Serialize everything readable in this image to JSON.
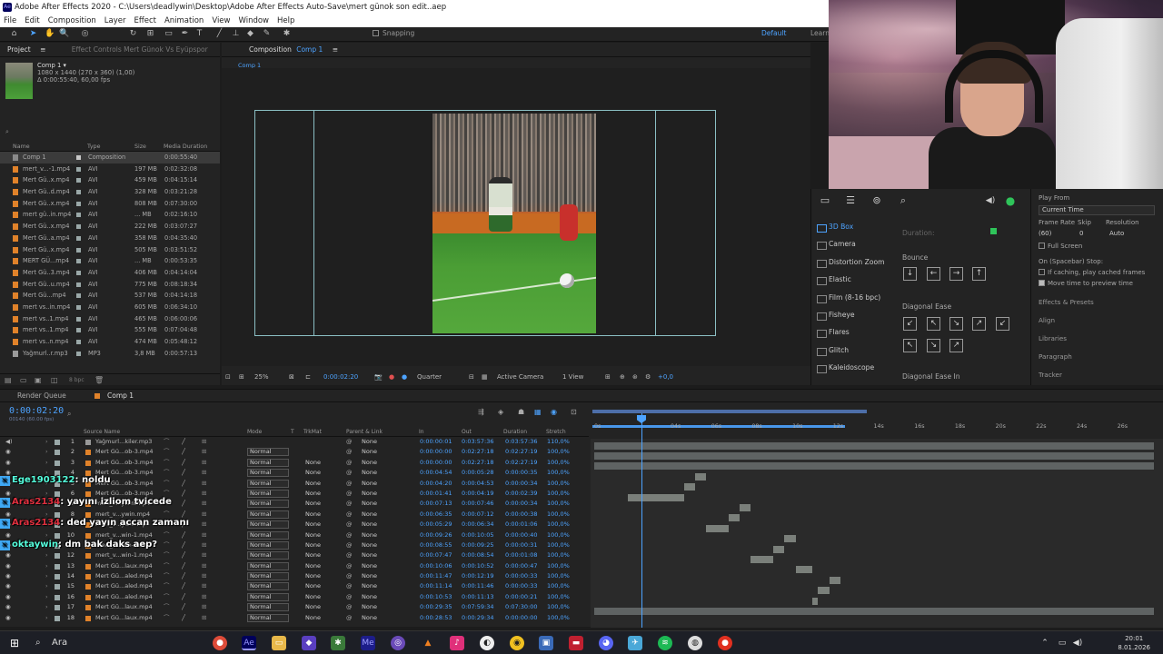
{
  "window": {
    "title": "Adobe After Effects 2020 - C:\\Users\\deadlywin\\Desktop\\Adobe After Effects Auto-Save\\mert günok son edit..aep"
  },
  "menu": [
    "File",
    "Edit",
    "Composition",
    "Layer",
    "Effect",
    "Animation",
    "View",
    "Window",
    "Help"
  ],
  "toolbar": {
    "snapping": "Snapping",
    "workspace": "Default",
    "learn": "Learn"
  },
  "project": {
    "tab": "Project",
    "tab2": "Effect Controls Mert Günok Vs Eyüpspor",
    "comp_name": "Comp 1 ▾",
    "comp_info1": "1080 x 1440  (270 x 360) (1,00)",
    "comp_info2": "Δ 0:00:55:40, 60,00 fps",
    "columns": {
      "name": "Name",
      "type": "Type",
      "size": "Size",
      "duration": "Media Duration"
    },
    "items": [
      {
        "name": "Comp 1",
        "type": "Composition",
        "size": "",
        "duration": "0:00:55:40",
        "kind": "comp"
      },
      {
        "name": "mert_v...-1.mp4",
        "type": "AVI",
        "size": "197 MB",
        "duration": "0:02:32:08",
        "kind": "avi"
      },
      {
        "name": "Mert Gü..x.mp4",
        "type": "AVI",
        "size": "459 MB",
        "duration": "0:04:15:14",
        "kind": "avi"
      },
      {
        "name": "Mert Gü..d.mp4",
        "type": "AVI",
        "size": "328 MB",
        "duration": "0:03:21:28",
        "kind": "avi"
      },
      {
        "name": "Mert Gü..x.mp4",
        "type": "AVI",
        "size": "808 MB",
        "duration": "0:07:30:00",
        "kind": "avi"
      },
      {
        "name": "mert gü..in.mp4",
        "type": "AVI",
        "size": "... MB",
        "duration": "0:02:16:10",
        "kind": "avi"
      },
      {
        "name": "Mert Gü..x.mp4",
        "type": "AVI",
        "size": "222 MB",
        "duration": "0:03:07:27",
        "kind": "avi"
      },
      {
        "name": "Mert Gü..a.mp4",
        "type": "AVI",
        "size": "358 MB",
        "duration": "0:04:35:40",
        "kind": "avi"
      },
      {
        "name": "Mert Gü..x.mp4",
        "type": "AVI",
        "size": "505 MB",
        "duration": "0:03:51:52",
        "kind": "avi"
      },
      {
        "name": "MERT GÜ...mp4",
        "type": "AVI",
        "size": "... MB",
        "duration": "0:00:53:35",
        "kind": "avi"
      },
      {
        "name": "Mert Gü..3.mp4",
        "type": "AVI",
        "size": "406 MB",
        "duration": "0:04:14:04",
        "kind": "avi"
      },
      {
        "name": "Mert Gü..u.mp4",
        "type": "AVI",
        "size": "775 MB",
        "duration": "0:08:18:34",
        "kind": "avi"
      },
      {
        "name": "Mert Gü...mp4",
        "type": "AVI",
        "size": "537 MB",
        "duration": "0:04:14:18",
        "kind": "avi"
      },
      {
        "name": "mert vs..in.mp4",
        "type": "AVI",
        "size": "605 MB",
        "duration": "0:06:34:10",
        "kind": "avi"
      },
      {
        "name": "mert vs..1.mp4",
        "type": "AVI",
        "size": "465 MB",
        "duration": "0:06:00:06",
        "kind": "avi"
      },
      {
        "name": "mert vs..1.mp4",
        "type": "AVI",
        "size": "555 MB",
        "duration": "0:07:04:48",
        "kind": "avi"
      },
      {
        "name": "mert vs..n.mp4",
        "type": "AVI",
        "size": "474 MB",
        "duration": "0:05:48:12",
        "kind": "avi"
      },
      {
        "name": "Yağmurl..r.mp3",
        "type": "MP3",
        "size": "3,8 MB",
        "duration": "0:00:57:13",
        "kind": "mp3"
      }
    ],
    "bpc": "8 bpc"
  },
  "composition": {
    "tab": "Composition",
    "tab_name": "Comp 1",
    "breadcrumb": "Comp 1",
    "zoom": "25%",
    "timecode": "0:00:02:20",
    "resolution": "Quarter",
    "camera": "Active Camera",
    "views": "1 View",
    "exposure": "+0,0"
  },
  "effects": {
    "items": [
      "3D Box",
      "Camera",
      "Distortion Zoom",
      "Elastic",
      "Film (8-16 bpc)",
      "Fisheye",
      "Flares",
      "Glitch",
      "Kaleidoscope"
    ],
    "duration_label": "Duration:",
    "bounce": "Bounce",
    "diag1": "Diagonal Ease",
    "diag2": "Diagonal Ease In"
  },
  "preview": {
    "play_from": "Play From",
    "current_time": "Current Time",
    "frame_rate": "Frame Rate",
    "skip": "Skip",
    "resolution": "Resolution",
    "fr_val": "(60)",
    "skip_val": "0",
    "res_val": "Auto",
    "full_screen": "Full Screen",
    "spacebar": "On (Spacebar) Stop:",
    "caching": "If caching, play cached frames",
    "move_time": "Move time to preview time",
    "libs": [
      "Effects & Presets",
      "Align",
      "Libraries",
      "Paragraph",
      "Tracker"
    ]
  },
  "timeline": {
    "tab1": "Render Queue",
    "tab2": "Comp 1",
    "timecode": "0:00:02:20",
    "fps": "00140 (60.00 fps)",
    "columns": {
      "source": "Source Name",
      "mode": "Mode",
      "t": "T",
      "trkmat": "TrkMat",
      "parent": "Parent & Link",
      "in": "In",
      "out": "Out",
      "duration": "Duration",
      "stretch": "Stretch"
    },
    "ruler": [
      "0s",
      "04s",
      "06s",
      "08s",
      "10s",
      "12s",
      "14s",
      "16s",
      "18s",
      "20s",
      "22s",
      "24s",
      "26s"
    ],
    "layers": [
      {
        "n": "1",
        "name": "Yağmurl...kiler.mp3",
        "mode": "",
        "trk": "",
        "parent": "None",
        "in": "0:00:00:01",
        "out": "0:03:57:36",
        "dur": "0:03:57:36",
        "str": "110,0%",
        "kind": "mp3",
        "bar": [
          0,
          100
        ]
      },
      {
        "n": "2",
        "name": "Mert Gü...ob-3.mp4",
        "mode": "Normal",
        "trk": "",
        "parent": "None",
        "in": "0:00:00:00",
        "out": "0:02:27:18",
        "dur": "0:02:27:19",
        "str": "100,0%",
        "kind": "avi",
        "bar": [
          0,
          100
        ]
      },
      {
        "n": "3",
        "name": "Mert Gü...ob-3.mp4",
        "mode": "Normal",
        "trk": "None",
        "parent": "None",
        "in": "0:00:00:00",
        "out": "0:02:27:18",
        "dur": "0:02:27:19",
        "str": "100,0%",
        "kind": "avi",
        "bar": [
          0,
          100
        ]
      },
      {
        "n": "4",
        "name": "Mert Gü...ob-3.mp4",
        "mode": "Normal",
        "trk": "None",
        "parent": "None",
        "in": "0:00:04:54",
        "out": "0:00:05:28",
        "dur": "0:00:00:35",
        "str": "100,0%",
        "kind": "avi",
        "bar": [
          18,
          20
        ]
      },
      {
        "n": "5",
        "name": "Mert Gü...ob-3.mp4",
        "mode": "Normal",
        "trk": "None",
        "parent": "None",
        "in": "0:00:04:20",
        "out": "0:00:04:53",
        "dur": "0:00:00:34",
        "str": "100,0%",
        "kind": "avi",
        "bar": [
          16,
          18
        ]
      },
      {
        "n": "6",
        "name": "Mert Gü...ob-3.mp4",
        "mode": "Normal",
        "trk": "None",
        "parent": "None",
        "in": "0:00:01:41",
        "out": "0:00:04:19",
        "dur": "0:00:02:39",
        "str": "100,0%",
        "kind": "avi",
        "bar": [
          6,
          16
        ]
      },
      {
        "n": "7",
        "name": "mert_v...ywin.mp4",
        "mode": "Normal",
        "trk": "None",
        "parent": "None",
        "in": "0:00:07:13",
        "out": "0:00:07:46",
        "dur": "0:00:00:34",
        "str": "100,0%",
        "kind": "avi",
        "bar": [
          26,
          28
        ]
      },
      {
        "n": "8",
        "name": "mert_v...ywin.mp4",
        "mode": "Normal",
        "trk": "None",
        "parent": "None",
        "in": "0:00:06:35",
        "out": "0:00:07:12",
        "dur": "0:00:00:38",
        "str": "100,0%",
        "kind": "avi",
        "bar": [
          24,
          26
        ]
      },
      {
        "n": "9",
        "name": "mert_v...ywin.mp4",
        "mode": "Normal",
        "trk": "None",
        "parent": "None",
        "in": "0:00:05:29",
        "out": "0:00:06:34",
        "dur": "0:00:01:06",
        "str": "100,0%",
        "kind": "avi",
        "bar": [
          20,
          24
        ]
      },
      {
        "n": "10",
        "name": "mert_v...win-1.mp4",
        "mode": "Normal",
        "trk": "None",
        "parent": "None",
        "in": "0:00:09:26",
        "out": "0:00:10:05",
        "dur": "0:00:00:40",
        "str": "100,0%",
        "kind": "avi",
        "bar": [
          34,
          36
        ]
      },
      {
        "n": "11",
        "name": "mert_v...win-1.mp4",
        "mode": "Normal",
        "trk": "None",
        "parent": "None",
        "in": "0:00:08:55",
        "out": "0:00:09:25",
        "dur": "0:00:00:31",
        "str": "100,0%",
        "kind": "avi",
        "bar": [
          32,
          34
        ]
      },
      {
        "n": "12",
        "name": "mert_v...win-1.mp4",
        "mode": "Normal",
        "trk": "None",
        "parent": "None",
        "in": "0:00:07:47",
        "out": "0:00:08:54",
        "dur": "0:00:01:08",
        "str": "100,0%",
        "kind": "avi",
        "bar": [
          28,
          32
        ]
      },
      {
        "n": "13",
        "name": "Mert Gü...laux.mp4",
        "mode": "Normal",
        "trk": "None",
        "parent": "None",
        "in": "0:00:10:06",
        "out": "0:00:10:52",
        "dur": "0:00:00:47",
        "str": "100,0%",
        "kind": "avi",
        "bar": [
          36,
          39
        ]
      },
      {
        "n": "14",
        "name": "Mert Gü...aled.mp4",
        "mode": "Normal",
        "trk": "None",
        "parent": "None",
        "in": "0:00:11:47",
        "out": "0:00:12:19",
        "dur": "0:00:00:33",
        "str": "100,0%",
        "kind": "avi",
        "bar": [
          42,
          44
        ]
      },
      {
        "n": "15",
        "name": "Mert Gü...aled.mp4",
        "mode": "Normal",
        "trk": "None",
        "parent": "None",
        "in": "0:00:11:14",
        "out": "0:00:11:46",
        "dur": "0:00:00:33",
        "str": "100,0%",
        "kind": "avi",
        "bar": [
          40,
          42
        ]
      },
      {
        "n": "16",
        "name": "Mert Gü...aled.mp4",
        "mode": "Normal",
        "trk": "None",
        "parent": "None",
        "in": "0:00:10:53",
        "out": "0:00:11:13",
        "dur": "0:00:00:21",
        "str": "100,0%",
        "kind": "avi",
        "bar": [
          39,
          40
        ]
      },
      {
        "n": "17",
        "name": "Mert Gü...laux.mp4",
        "mode": "Normal",
        "trk": "None",
        "parent": "None",
        "in": "0:00:29:35",
        "out": "0:07:59:34",
        "dur": "0:07:30:00",
        "str": "100,0%",
        "kind": "avi",
        "bar": [
          0,
          100
        ]
      },
      {
        "n": "18",
        "name": "Mert Gü...laux.mp4",
        "mode": "Normal",
        "trk": "None",
        "parent": "None",
        "in": "0:00:28:53",
        "out": "0:00:29:34",
        "dur": "0:00:00:00",
        "str": "100,0%",
        "kind": "avi",
        "bar": [
          0,
          0
        ]
      }
    ]
  },
  "chat": [
    {
      "user": "Ege1903122",
      "msg": ": noldu",
      "user_color": "#5fd"
    },
    {
      "user": "Aras2134",
      "msg": ": yayını izliom tvicede",
      "user_color": "#e0303f"
    },
    {
      "user": "Aras2134",
      "msg": ": ded yayın accan zamanı",
      "user_color": "#e0303f"
    },
    {
      "user": "oktaywin",
      "msg": ": dm bak daks aep?",
      "user_color": "#5fd"
    }
  ],
  "taskbar": {
    "search": "Ara",
    "time": "20:01",
    "date": "8.01.2026"
  }
}
